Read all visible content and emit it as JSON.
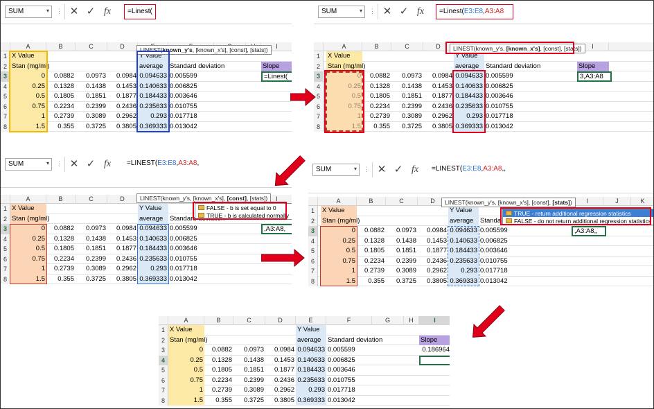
{
  "panels": [
    {
      "id": "p1",
      "namebox": "SUM",
      "formula": "=Linest(",
      "formula_parts": [
        {
          "t": "=Linest(",
          "c": "#000"
        }
      ],
      "tooltip": {
        "pre": "LINEST(",
        "bold": "known_y's",
        "post": ", [known_x's], [const], [stats])"
      },
      "cols": [
        "A",
        "B",
        "C",
        "D",
        "E",
        "F",
        "G",
        "H",
        "I"
      ],
      "active_col": "",
      "active_row": "3",
      "active_cell_text": "=Linest(",
      "slope_label": "Slope"
    },
    {
      "id": "p2",
      "namebox": "SUM",
      "formula_parts": [
        {
          "t": "=Linest(",
          "c": "#000"
        },
        {
          "t": "E3:E8",
          "c": "#2f6fd8"
        },
        {
          "t": ",",
          "c": "#000"
        },
        {
          "t": "A3:A8",
          "c": "#d1232a"
        }
      ],
      "tooltip": {
        "pre": "LINEST(known_y's, ",
        "bold": "[known_x's]",
        "post": ", [const], [stats])"
      },
      "active_cell_text": "3,A3:A8",
      "slope_label": "Slope"
    },
    {
      "id": "p3",
      "namebox": "SUM",
      "formula_parts": [
        {
          "t": "=LINEST(",
          "c": "#000"
        },
        {
          "t": "E3:E8",
          "c": "#2f6fd8"
        },
        {
          "t": ",",
          "c": "#000"
        },
        {
          "t": "A3:A8",
          "c": "#d1232a"
        },
        {
          "t": ",",
          "c": "#000"
        }
      ],
      "tooltip": {
        "pre": "LINEST(known_y's, [known_x's], ",
        "bold": "[const]",
        "post": ", [stats])"
      },
      "dropdown": [
        "FALSE - b is set equal to 0",
        "TRUE - b is calculated normally"
      ],
      "active_cell_text": ",A3:A8,",
      "slope_label": "Slope"
    },
    {
      "id": "p4",
      "namebox": "SUM",
      "formula_parts": [
        {
          "t": "=LINEST(",
          "c": "#000"
        },
        {
          "t": "E3:E8",
          "c": "#2f6fd8"
        },
        {
          "t": ",",
          "c": "#000"
        },
        {
          "t": "A3:A8",
          "c": "#d1232a"
        },
        {
          "t": ",,",
          "c": "#000"
        }
      ],
      "tooltip": {
        "pre": "LINEST(known_y's, [known_x's], [const], ",
        "bold": "[stats]",
        "post": ")"
      },
      "dropdown": [
        "TRUE - return additional regression statistics",
        "FALSE - do not return additional regression statistics"
      ],
      "active_cell_text": ",A3:A8,,",
      "slope_label": "Slope"
    },
    {
      "id": "p5",
      "result": "0.186964",
      "slope_label": "Slope"
    }
  ],
  "sheet": {
    "hdr_x": "X Value",
    "hdr_x2": "Stan (mg/ml)",
    "hdr_y": "Y Value",
    "hdr_y2": "average",
    "hdr_sd": "Standard deviation",
    "hdr_sd_short": "Standa",
    "rows": [
      {
        "n": "3",
        "a": "0",
        "b": "0.0882",
        "c": "0.0973",
        "d": "0.0984",
        "e": "0.094633",
        "f": "0.005599"
      },
      {
        "n": "4",
        "a": "0.25",
        "b": "0.1328",
        "c": "0.1438",
        "d": "0.1453",
        "e": "0.140633",
        "f": "0.006825"
      },
      {
        "n": "5",
        "a": "0.5",
        "b": "0.1805",
        "c": "0.1851",
        "d": "0.1877",
        "e": "0.184433",
        "f": "0.003646"
      },
      {
        "n": "6",
        "a": "0.75",
        "b": "0.2234",
        "c": "0.2399",
        "d": "0.2436",
        "e": "0.235633",
        "f": "0.010755"
      },
      {
        "n": "7",
        "a": "1",
        "b": "0.2739",
        "c": "0.3089",
        "d": "0.2962",
        "e": "0.293",
        "f": "0.017718"
      },
      {
        "n": "8",
        "a": "1.5",
        "b": "0.355",
        "c": "0.3725",
        "d": "0.3805",
        "e": "0.369333",
        "f": "0.013042"
      }
    ]
  },
  "colors": {
    "red": "#e0001b",
    "blue": "#1f3fd6",
    "yellow": "#f5b800",
    "arrow": "#e0001b"
  }
}
